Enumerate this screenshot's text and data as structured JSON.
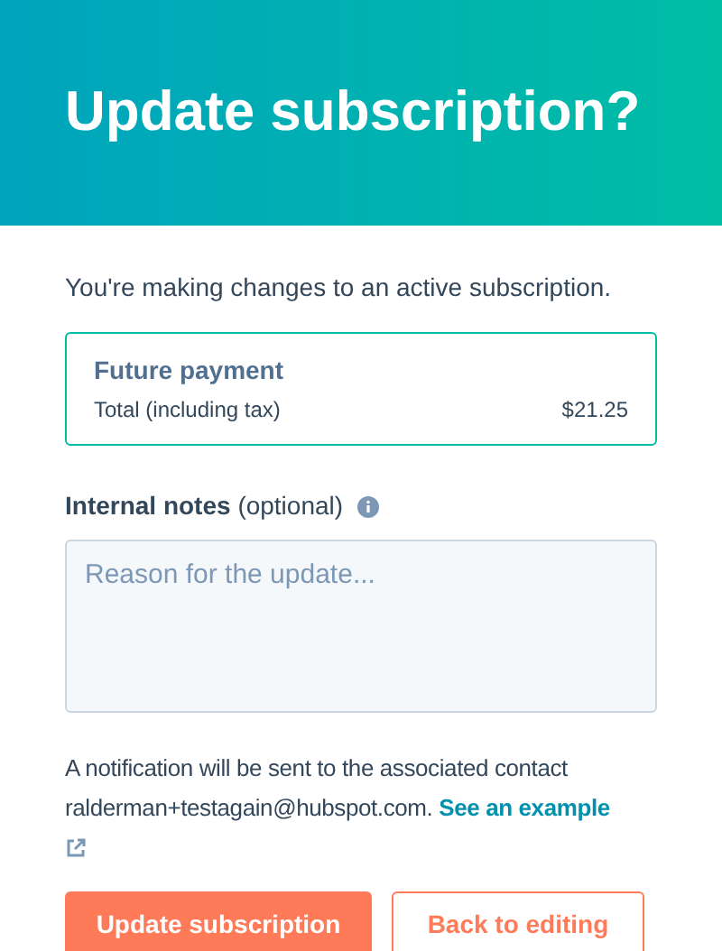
{
  "header": {
    "title": "Update subscription?"
  },
  "intro": "You're making changes to an active subscription.",
  "payment": {
    "title": "Future payment",
    "label": "Total (including tax)",
    "amount": "$21.25"
  },
  "notes": {
    "label": "Internal notes",
    "optional": "(optional)",
    "placeholder": "Reason for the update..."
  },
  "notification": {
    "text": "A notification will be sent to the associated contact ralderman+testagain@hubspot.com.",
    "link": "See an example"
  },
  "buttons": [
    {
      "label": "Update subscription",
      "kind": "primary"
    },
    {
      "label": "Back to editing",
      "kind": "secondary"
    }
  ]
}
